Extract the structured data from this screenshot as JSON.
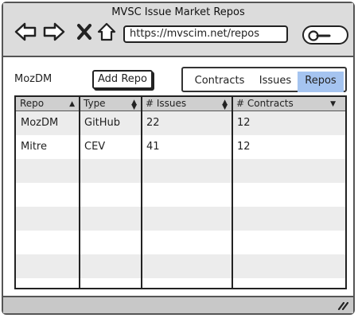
{
  "window": {
    "title": "MVSC Issue Market Repos"
  },
  "browser": {
    "url": "https://mvscim.net/repos",
    "icons": [
      "back-arrow-icon",
      "forward-arrow-icon",
      "close-icon",
      "home-icon",
      "search-icon"
    ]
  },
  "toolbar": {
    "org_label": "MozDM",
    "add_button": "Add Repo",
    "tabs": [
      {
        "label": "Contracts",
        "active": false
      },
      {
        "label": "Issues",
        "active": false
      },
      {
        "label": "Repos",
        "active": true
      }
    ]
  },
  "table": {
    "columns": [
      {
        "label": "Repo",
        "sort": "asc"
      },
      {
        "label": "Type",
        "sort": "both"
      },
      {
        "label": "# Issues",
        "sort": "both"
      },
      {
        "label": "# Contracts",
        "sort": "desc"
      }
    ],
    "rows": [
      {
        "repo": "MozDM",
        "type": "GitHub",
        "issues": "22",
        "contracts": "12"
      },
      {
        "repo": "Mitre",
        "type": "CEV",
        "issues": "41",
        "contracts": "12"
      }
    ]
  },
  "colors": {
    "active_tab": "#a5c4f0",
    "chrome": "#dcdcdc",
    "row_alt": "#ececec"
  }
}
